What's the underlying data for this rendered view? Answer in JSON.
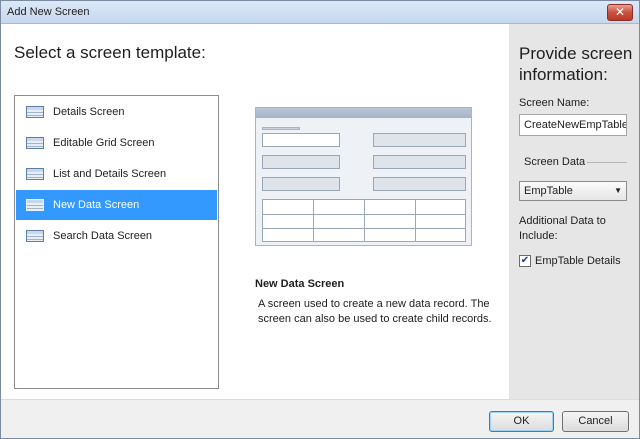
{
  "window": {
    "title": "Add New Screen"
  },
  "left": {
    "heading": "Select a screen template:",
    "templates": [
      {
        "label": "Details Screen",
        "icon": "details-screen-icon"
      },
      {
        "label": "Editable Grid Screen",
        "icon": "grid-screen-icon"
      },
      {
        "label": "List and Details Screen",
        "icon": "list-details-screen-icon"
      },
      {
        "label": "New Data Screen",
        "icon": "new-data-screen-icon",
        "selected": true
      },
      {
        "label": "Search Data Screen",
        "icon": "search-screen-icon"
      }
    ]
  },
  "preview": {
    "title": "New Data Screen",
    "description": "A screen used to create a new data record. The screen can also be used to create child records."
  },
  "right": {
    "heading": "Provide screen information:",
    "screen_name_label": "Screen Name:",
    "screen_name_value": "CreateNewEmpTable",
    "screen_data_group": "Screen Data",
    "screen_data_value": "EmpTable",
    "additional_label": "Additional Data to Include:",
    "checkbox_label": "EmpTable Details",
    "checkbox_checked": true
  },
  "buttons": {
    "ok": "OK",
    "cancel": "Cancel"
  },
  "colors": {
    "selection": "#3399ff",
    "titlebar": "#c7d8ee",
    "close": "#c9503f"
  }
}
